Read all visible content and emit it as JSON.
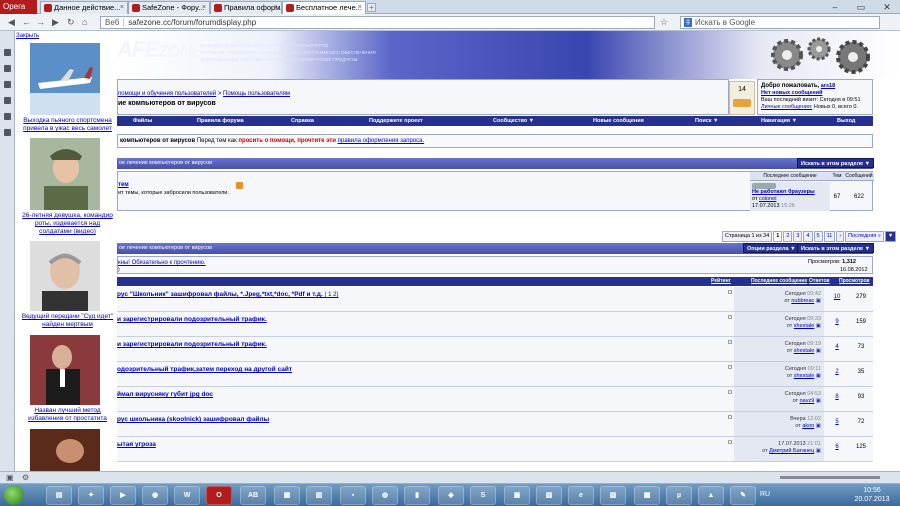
{
  "browser": {
    "opera_label": "Opera",
    "tabs": [
      {
        "label": "Данное действие..."
      },
      {
        "label": "SafeZone - Фору..."
      },
      {
        "label": "Правила оформл..."
      },
      {
        "label": "Бесплатное лече..."
      }
    ],
    "url_prefix": "Веб",
    "url": "safezone.cc/forum/forumdisplay.php",
    "search_placeholder": "Искать в Google"
  },
  "ads": {
    "close_label": "Закрыть",
    "items": [
      {
        "caption": "Выходка пьяного спортсмена привела в ужас весь самолет"
      },
      {
        "caption": "26-летняя девушка, командир роты, издевается над солдатами (видео)"
      },
      {
        "caption": "Ведущий передачи \"Суд идет\" найден мертвым"
      },
      {
        "caption": "Назван лучший метод избавления от простатита"
      }
    ]
  },
  "site": {
    "logo_part": "AFE",
    "logo_rest": "ZONE",
    "taglines": [
      "ЛЕЧЕНИЕ ОТ ВИРУСОВ ПЕРСОНАЛЬНЫХ КОМПЬЮТЕРОВ",
      "ОБУЧЕНИЕ ГРАМОТНОМУ ИСПОЛЬЗОВАНИЮ ПРОГРАММНОГО ОБЕСПЕЧЕНИЯ",
      "ОПЕРАЦИОННЫЕ СИСТЕМЫ • НОВОСТИ • АНТИВИРУСНЫЕ ПРОДУКТЫ"
    ],
    "breadcrumb_a": "помощи и обучения пользователей",
    "breadcrumb_sep": ">",
    "breadcrumb_b": "Помощь пользователям",
    "forum_title": "ие компьютеров от вирусов",
    "counter": "14",
    "welcome": {
      "greeting": "Добро пожаловать,",
      "user": "ars18",
      "new_msgs": "Нет новых сообщений",
      "last_visit": "Ваш последний визит: Сегодня в 09:51",
      "pm_link": "Личные сообщения:",
      "pm_counts": "Новых 0, всего 0."
    },
    "menu": [
      "Файлы",
      "Правила форума",
      "Справка",
      "Поддержите проект",
      "Сообщество ▼",
      "Новые сообщения",
      "Поиск ▼",
      "Навигация ▼",
      "Выход"
    ],
    "info": {
      "title": "компьютеров от вирусов",
      "pre": "Перед тем как",
      "red": "просить о помощи, прочтите эти",
      "link": "правила оформления запроса."
    },
    "subforum": {
      "bar": "ое лечение компьютеров от вирусов",
      "btn": "Искать в этом разделе ▼",
      "hdr_last": "Последнее сообщение",
      "hdr_topics": "Тем",
      "hdr_posts": "Сообщений",
      "topic_link": "тем",
      "topic_desc": "ит темы, которые забросили пользователи.",
      "lp_title": "Не работают браузеры",
      "lp_by": "от",
      "lp_user": "colonel",
      "lp_date": "17.07.2013",
      "lp_time": "15:26",
      "topics": "67",
      "posts": "622"
    },
    "pagination": {
      "label": "Страница 1 из 34",
      "pages": [
        "1",
        "2",
        "3",
        "4",
        "5",
        "11",
        "›",
        "Последняя »"
      ]
    },
    "listbar": "ое лечение компьютеров от вирусов",
    "opts_btn": "Опции раздела ▼",
    "search_btn": "Искать в этом разделе ▼",
    "announcement": {
      "text": "кны! Обязательно к прочтению.",
      "views_label": "Просмотров:",
      "views": "1,312",
      "date": "16.08.2012"
    },
    "list_headers": {
      "rating": "Рейтинг",
      "last": "Последнее сообщение",
      "replies": "Ответов",
      "views": "Просмотров"
    },
    "threads": [
      {
        "title": "рус \"Школьник\" зашифровал файлы, *.Jpeg,*txt,*doc, *Pdf и т.д.",
        "pages": "( 1 2)",
        "date": "Сегодня",
        "time": "09:42",
        "by": "от",
        "user": "nubbreac",
        "replies": "10",
        "views": "279"
      },
      {
        "title": "и зарегистрировали подозрительный трафик.",
        "pages": "",
        "date": "Сегодня",
        "time": "09:33",
        "by": "от",
        "user": "shestale",
        "replies": "9",
        "views": "159"
      },
      {
        "title": "и зарегистрировали подозрительный трафик.",
        "pages": "",
        "date": "Сегодня",
        "time": "09:19",
        "by": "от",
        "user": "shestale",
        "replies": "4",
        "views": "73"
      },
      {
        "title": "одозрительный трафик,затем переход на другой сайт",
        "pages": "",
        "date": "Сегодня",
        "time": "09:11",
        "by": "от",
        "user": "shestale",
        "replies": "2",
        "views": "35"
      },
      {
        "title": "ймал вирусняку губит jpg doc",
        "pages": "",
        "date": "Сегодня",
        "time": "04:53",
        "by": "от",
        "user": "oavz9",
        "replies": "8",
        "views": "93"
      },
      {
        "title": "рус школьника (skoolnick) зашифровал файлы",
        "pages": "",
        "date": "Вчера",
        "time": "12:02",
        "by": "от",
        "user": "akon",
        "replies": "5",
        "views": "72"
      },
      {
        "title": "ытая угроза",
        "pages": "",
        "date": "17.07.2013",
        "time": "21:01",
        "by": "от",
        "user": "Дмитрий Батанец",
        "replies": "6",
        "views": "125"
      }
    ]
  },
  "taskbar": {
    "lang": "RU",
    "time": "10:56",
    "date": "20.07.2013"
  }
}
